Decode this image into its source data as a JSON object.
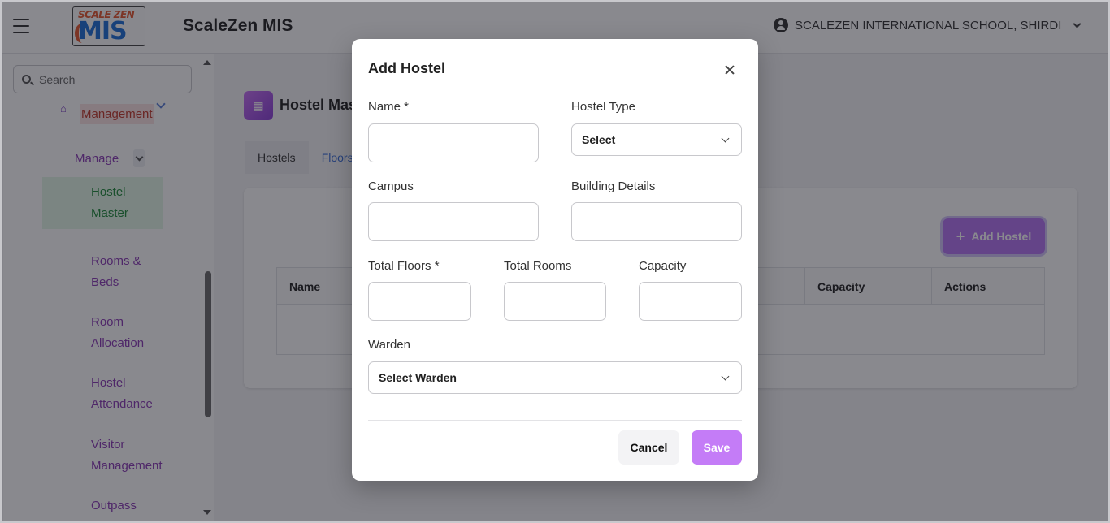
{
  "header": {
    "logo_top": "SCALE ZEN",
    "logo_main": "MIS",
    "app_title": "ScaleZen MIS",
    "school_name": "SCALEZEN INTERNATIONAL SCHOOL, SHIRDI"
  },
  "sidebar": {
    "search_placeholder": "Search",
    "management_label": "Management",
    "manage_label": "Manage",
    "items": [
      {
        "label": "Hostel Master",
        "active": true
      },
      {
        "label": "Rooms & Beds"
      },
      {
        "label": "Room Allocation"
      },
      {
        "label": "Hostel Attendance"
      },
      {
        "label": "Visitor Management"
      },
      {
        "label": "Outpass Management"
      }
    ]
  },
  "main": {
    "title": "Hostel Mas",
    "tabs": [
      {
        "label": "Hostels"
      },
      {
        "label": "Floors"
      }
    ],
    "add_button": "Add Hostel",
    "table_headers": {
      "name": "Name",
      "capacity": "Capacity",
      "actions": "Actions"
    }
  },
  "modal": {
    "title": "Add Hostel",
    "fields": {
      "name": {
        "label": "Name *",
        "value": ""
      },
      "hostel_type": {
        "label": "Hostel Type",
        "value": "Select"
      },
      "campus": {
        "label": "Campus",
        "value": ""
      },
      "building_details": {
        "label": "Building Details",
        "value": ""
      },
      "total_floors": {
        "label": "Total Floors *",
        "value": ""
      },
      "total_rooms": {
        "label": "Total Rooms",
        "value": ""
      },
      "capacity": {
        "label": "Capacity",
        "value": ""
      },
      "warden": {
        "label": "Warden",
        "value": "Select Warden"
      }
    },
    "cancel_label": "Cancel",
    "save_label": "Save"
  },
  "colors": {
    "accent": "#c47cf7",
    "sidebar_link": "#8a3bb5",
    "active_item": "#1f8b3a",
    "overlay": "rgba(20,20,30,0.5)"
  }
}
